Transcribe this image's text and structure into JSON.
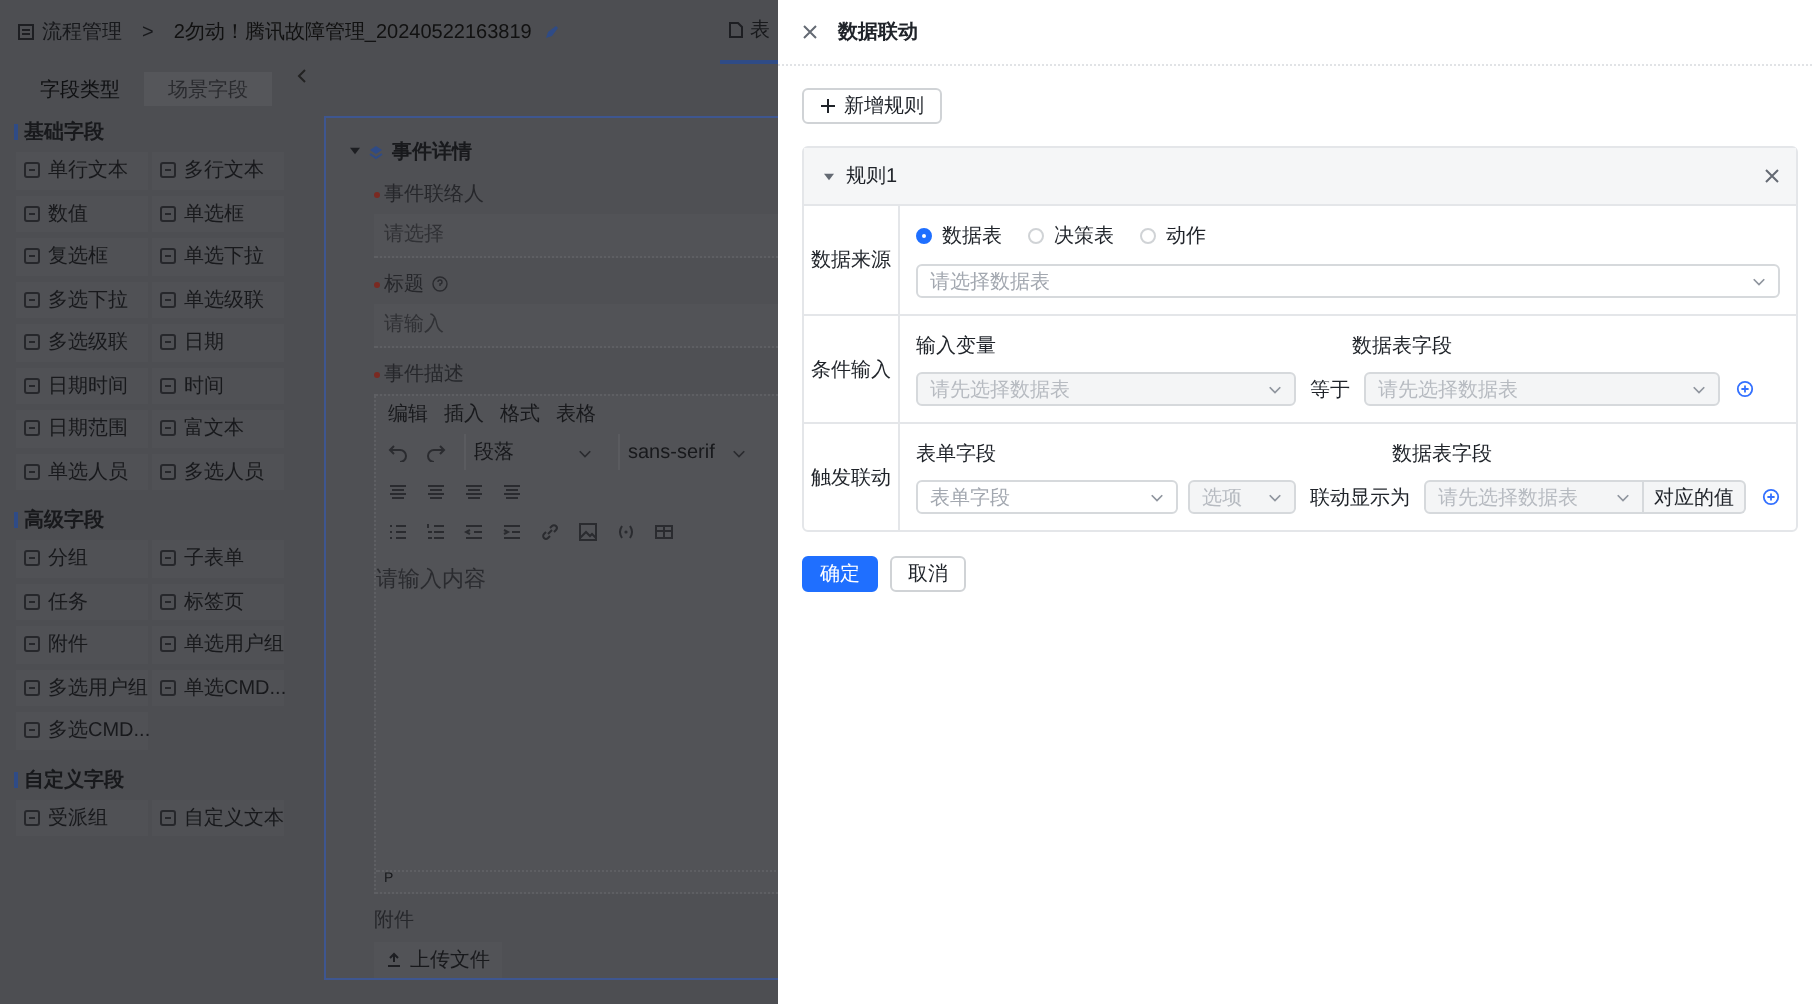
{
  "breadcrumb": {
    "root": "流程管理",
    "separator": ">",
    "current": "2勿动！腾讯故障管理_20240522163819"
  },
  "top_tabs": [
    {
      "label": "表",
      "selected": true
    }
  ],
  "sidebar": {
    "tabs": [
      {
        "label": "字段类型",
        "selected": true
      },
      {
        "label": "场景字段",
        "selected": false
      }
    ],
    "sections": [
      {
        "title": "基础字段",
        "items": [
          "单行文本",
          "多行文本",
          "数值",
          "单选框",
          "复选框",
          "单选下拉",
          "多选下拉",
          "单选级联",
          "多选级联",
          "日期",
          "日期时间",
          "时间",
          "日期范围",
          "富文本",
          "单选人员",
          "多选人员"
        ]
      },
      {
        "title": "高级字段",
        "items": [
          "分组",
          "子表单",
          "任务",
          "标签页",
          "附件",
          "单选用户组",
          "多选用户组",
          "单选CMD...",
          "多选CMD..."
        ]
      },
      {
        "title": "自定义字段",
        "items": [
          "受派组",
          "自定义文本"
        ]
      }
    ]
  },
  "canvas": {
    "group": {
      "title": "事件详情",
      "expanded": true
    },
    "fields": [
      {
        "kind": "select",
        "label": "事件联络人",
        "required": true,
        "help": false,
        "placeholder": "请选择"
      },
      {
        "kind": "input",
        "label": "标题",
        "required": true,
        "help": true,
        "placeholder": "请输入"
      },
      {
        "kind": "editor",
        "label": "事件描述",
        "required": true,
        "help": false,
        "menu": [
          "编辑",
          "插入",
          "格式",
          "表格"
        ],
        "block_format": "段落",
        "font": "sans-serif",
        "placeholder": "请输入内容",
        "status": "P"
      },
      {
        "kind": "upload",
        "label": "附件",
        "required": false,
        "help": false,
        "button": "上传文件"
      }
    ]
  },
  "drawer": {
    "title": "数据联动",
    "add_button": "新增规则",
    "rules": [
      {
        "title": "规则1",
        "expanded": true,
        "source": {
          "label": "数据来源",
          "options": [
            {
              "label": "数据表",
              "selected": true
            },
            {
              "label": "决策表",
              "selected": false
            },
            {
              "label": "动作",
              "selected": false
            }
          ],
          "select": {
            "placeholder": "请选择数据表",
            "disabled": false
          }
        },
        "condition": {
          "label": "条件输入",
          "input_label": "输入变量",
          "input_select": {
            "placeholder": "请先选择数据表",
            "disabled": true
          },
          "operator": "等于",
          "field_label": "数据表字段",
          "field_select": {
            "placeholder": "请先选择数据表",
            "disabled": true
          }
        },
        "trigger": {
          "label": "触发联动",
          "form_field_label": "表单字段",
          "form_field_select": {
            "placeholder": "表单字段",
            "disabled": false
          },
          "option_select": {
            "placeholder": "选项",
            "disabled": true
          },
          "connector": "联动显示为",
          "field_label": "数据表字段",
          "field_select": {
            "placeholder": "请先选择数据表",
            "disabled": true
          },
          "value_addon": "对应的值"
        }
      }
    ],
    "footer": {
      "confirm": "确定",
      "cancel": "取消"
    }
  }
}
